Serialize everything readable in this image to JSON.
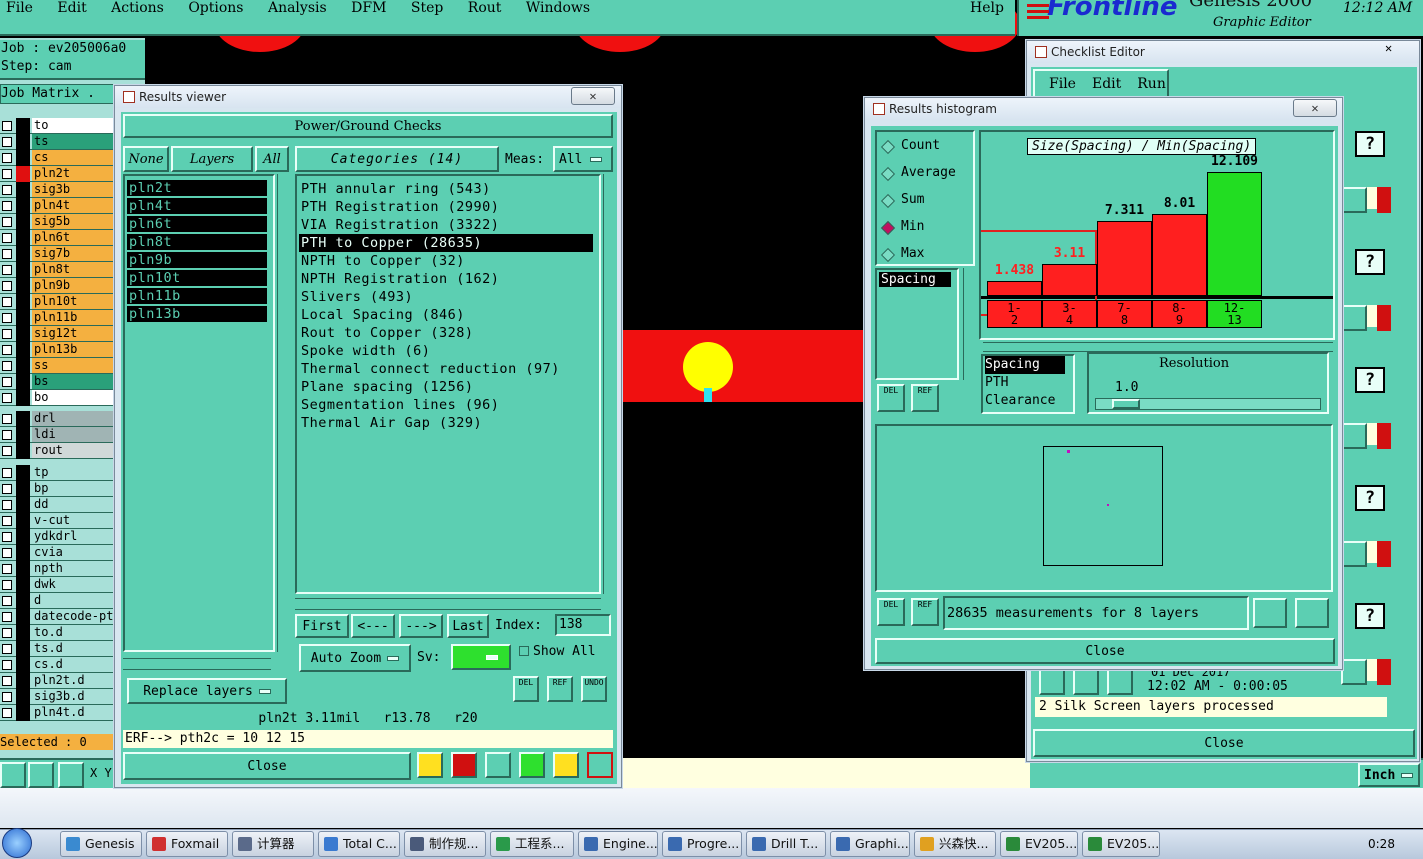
{
  "menubar": {
    "items": [
      "File",
      "Edit",
      "Actions",
      "Options",
      "Analysis",
      "DFM",
      "Step",
      "Rout",
      "Windows"
    ],
    "help": "Help"
  },
  "brand": {
    "logo": "Frontline",
    "product": "Genesis 2000",
    "subtitle": "Graphic Editor",
    "time": "12:12 AM"
  },
  "jobinfo": {
    "job": "Job : ev205006a0",
    "step": "Step: cam",
    "matrix": "Job Matrix ."
  },
  "layers": [
    {
      "name": "to",
      "color": "#ffffff"
    },
    {
      "name": "ts",
      "color": "#2aa07a"
    },
    {
      "name": "cs",
      "color": "#f4b040"
    },
    {
      "name": "pln2t",
      "color": "#f4b040"
    },
    {
      "name": "sig3b",
      "color": "#f4b040"
    },
    {
      "name": "pln4t",
      "color": "#f4b040"
    },
    {
      "name": "sig5b",
      "color": "#f4b040"
    },
    {
      "name": "pln6t",
      "color": "#f4b040"
    },
    {
      "name": "sig7b",
      "color": "#f4b040"
    },
    {
      "name": "pln8t",
      "color": "#f4b040"
    },
    {
      "name": "pln9b",
      "color": "#f4b040"
    },
    {
      "name": "pln10t",
      "color": "#f4b040"
    },
    {
      "name": "pln11b",
      "color": "#f4b040"
    },
    {
      "name": "sig12t",
      "color": "#f4b040"
    },
    {
      "name": "pln13b",
      "color": "#f4b040"
    },
    {
      "name": "ss",
      "color": "#f4b040"
    },
    {
      "name": "bs",
      "color": "#2aa07a"
    },
    {
      "name": "bo",
      "color": "#ffffff"
    }
  ],
  "drill_layers": [
    {
      "name": "drl",
      "color": "#a0b4b4"
    },
    {
      "name": "ldi",
      "color": "#a0b4b4"
    },
    {
      "name": "rout",
      "color": "#d0d8d8"
    }
  ],
  "misc_layers": [
    "tp",
    "bp",
    "dd",
    "v-cut",
    "ydkdrl",
    "cvia",
    "npth",
    "dwk",
    "d",
    "datecode-pt",
    "to.d",
    "ts.d",
    "cs.d",
    "pln2t.d",
    "sig3b.d",
    "pln4t.d"
  ],
  "selected": "Selected : 0",
  "xy": "X Y",
  "results_viewer": {
    "title": "Results viewer",
    "header": "Power/Ground Checks",
    "none": "None",
    "layers": "Layers",
    "all": "All",
    "categories_label": "Categories (14)",
    "meas_label": "Meas:",
    "meas_value": "All",
    "layer_list": [
      "pln2t",
      "pln4t",
      "pln6t",
      "pln8t",
      "pln9b",
      "pln10t",
      "pln11b",
      "pln13b"
    ],
    "categories": [
      "PTH annular ring (543)",
      "PTH Registration (2990)",
      "VIA Registration (3322)",
      "PTH to Copper (28635)",
      "NPTH to Copper (32)",
      "NPTH Registration (162)",
      "Slivers (493)",
      "Local Spacing (846)",
      "Rout to Copper (328)",
      "Spoke width (6)",
      "Thermal connect reduction (97)",
      "Plane spacing (1256)",
      "Segmentation lines (96)",
      "Thermal Air Gap (329)"
    ],
    "selected_category": "PTH to Copper (28635)",
    "nav": {
      "first": "First",
      "prev": "<---",
      "next": "--->",
      "last": "Last",
      "index_label": "Index:",
      "index_value": "138"
    },
    "autozoom": "Auto Zoom",
    "sv": "Sv:",
    "show_all": "Show All",
    "replace": "Replace layers",
    "status": "pln2t 3.11mil   r13.78   r20",
    "erf": "ERF--> pth2c = 10 12 15",
    "close": "Close",
    "del": "DEL",
    "ref": "REF",
    "undo": "UNDO"
  },
  "histogram": {
    "title": "Results histogram",
    "modes": [
      "Count",
      "Average",
      "Sum",
      "Min",
      "Max"
    ],
    "active_mode": "Min",
    "chart_title": "Size(Spacing) / Min(Spacing)",
    "list_item": "Spacing",
    "measures": [
      "Spacing",
      "PTH",
      "Clearance"
    ],
    "resolution_label": "Resolution",
    "resolution_value": "1.0",
    "footer": "28635 measurements for 8 layers",
    "close": "Close",
    "del": "DEL",
    "ref": "REF"
  },
  "chart_data": {
    "type": "bar",
    "title": "Size(Spacing) / Min(Spacing)",
    "categories": [
      "1-2",
      "3-4",
      "7-8",
      "8-9",
      "12-13"
    ],
    "values": [
      1.438,
      3.11,
      7.311,
      8.01,
      12.109
    ],
    "colors": [
      "#ff1f1f",
      "#ff1f1f",
      "#ff1f1f",
      "#ff1f1f",
      "#22dd22"
    ]
  },
  "checklist": {
    "title": "Checklist Editor",
    "menu": [
      "File",
      "Edit",
      "Run"
    ],
    "date": "01 Dec 2017",
    "timing": "12:02 AM - 0:00:05",
    "status": "2 Silk Screen layers processed",
    "close": "Close",
    "q": "?"
  },
  "bottom_bar": {
    "inch": "Inch"
  },
  "taskbar": {
    "items": [
      "Genesis",
      "Foxmail",
      "计算器",
      "Total C...",
      "制作规...",
      "工程系...",
      "Engine...",
      "Progre...",
      "Drill T...",
      "Graphi...",
      "兴森快...",
      "EV205...",
      "EV205..."
    ],
    "clock": "0:28"
  }
}
